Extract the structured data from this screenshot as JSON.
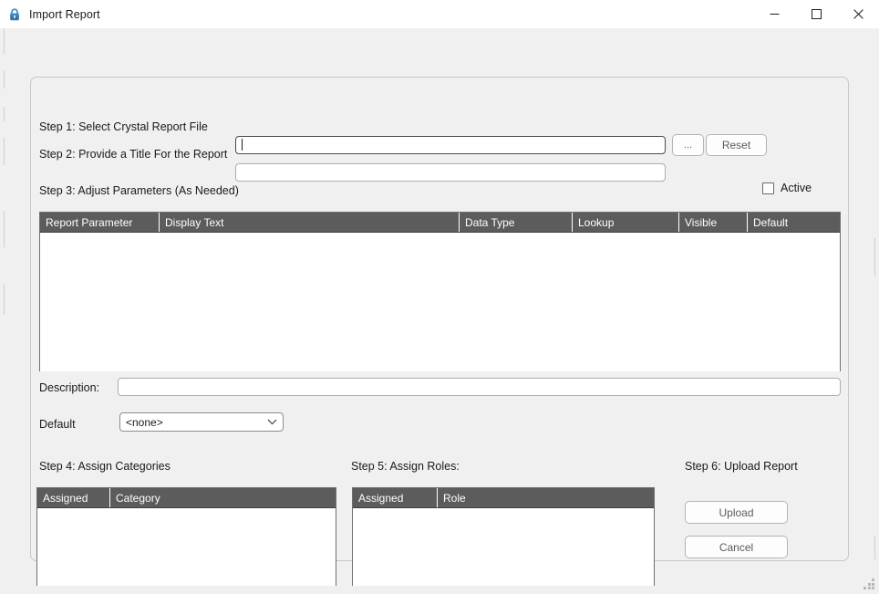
{
  "window": {
    "title": "Import Report",
    "icon": "lock-icon",
    "controls": {
      "minimize": "minimize-icon",
      "maximize": "maximize-icon",
      "close": "close-icon"
    }
  },
  "form": {
    "step1": {
      "label": "Step 1:  Select Crystal Report File",
      "file_value": "",
      "file_placeholder": "",
      "browse_label": "...",
      "reset_label": "Reset"
    },
    "step2": {
      "label": "Step 2:  Provide a Title For the Report",
      "title_value": "",
      "title_placeholder": ""
    },
    "step3": {
      "label": "Step 3:  Adjust Parameters (As Needed)",
      "active_label": "Active",
      "active_checked": false,
      "columns": [
        "Report Parameter",
        "Display Text",
        "Data Type",
        "Lookup",
        "Visible",
        "Default"
      ],
      "rows": []
    },
    "description": {
      "label": "Description:",
      "value": "",
      "placeholder": ""
    },
    "default": {
      "label": "Default",
      "selected": "<none>",
      "options": [
        "<none>"
      ]
    },
    "step4": {
      "label": "Step 4:  Assign Categories",
      "columns": [
        "Assigned",
        "Category"
      ],
      "rows": []
    },
    "step5": {
      "label": "Step 5:  Assign Roles:",
      "columns": [
        "Assigned",
        "Role"
      ],
      "rows": []
    },
    "step6": {
      "label": "Step 6:  Upload Report",
      "upload_label": "Upload",
      "cancel_label": "Cancel"
    }
  },
  "colors": {
    "window_bg": "#f0f0f0",
    "titlebar_bg": "#ffffff",
    "grid_header_bg": "#5c5c5c",
    "grid_header_fg": "#ffffff",
    "accent_lock": "#2d74a8",
    "button_fg": "#555b63"
  }
}
